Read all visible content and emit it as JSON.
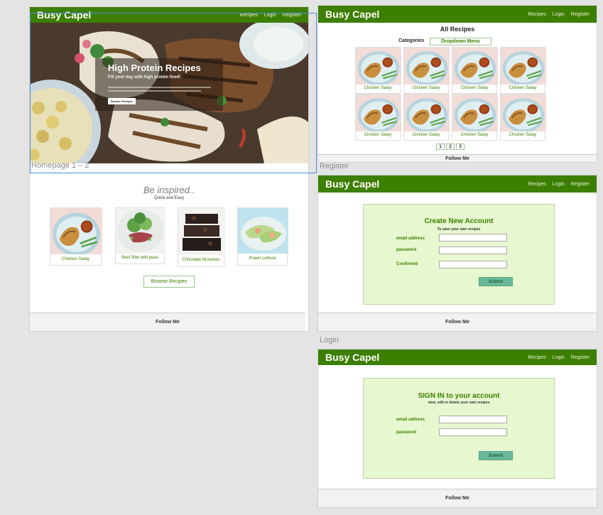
{
  "labels": {
    "homepage": "Homepage 1 – 2",
    "register": "Register",
    "login": "Login"
  },
  "nav": {
    "brand": "Busy Capel",
    "links": [
      "Recipes",
      "Login",
      "Register"
    ]
  },
  "footer": "Follow Me",
  "hero": {
    "title": "High Protein Recipes",
    "subtitle": "Fill your day with high protein food!",
    "button": "Browse Recipes"
  },
  "inspired": {
    "title": "Be inspired..",
    "subtitle": "Quick and Easy",
    "cards": [
      "Chicken Satay",
      "Beef fillet with peas",
      "Chocolate Brownies",
      "Prawn Lettuce"
    ],
    "button": "Browse Recipes"
  },
  "recipes": {
    "title": "All Recipes",
    "categories_label": "Categories",
    "dropdown": "Dropdown Menu",
    "items": [
      "Chicken Satay",
      "Chicken Satay",
      "Chicken Satay",
      "Chicken Satay",
      "Chicken Satay",
      "Chicken Satay",
      "Chicken Satay",
      "Chicken Satay"
    ],
    "pages": [
      "1",
      "2",
      "3"
    ]
  },
  "register": {
    "title": "Create New Account",
    "subtitle": "To save your own recipes",
    "fields": [
      "email address",
      "password",
      "Confirmed"
    ],
    "submit": "Submit"
  },
  "login": {
    "title": "SIGN IN to your account",
    "subtitle": "view, edit or delete your own recipes",
    "fields": [
      "email address",
      "password"
    ],
    "submit": "Submit"
  },
  "colors": {
    "nav": "#3d7f00",
    "panel": "#e7f7cf",
    "submit": "#68b99a"
  }
}
